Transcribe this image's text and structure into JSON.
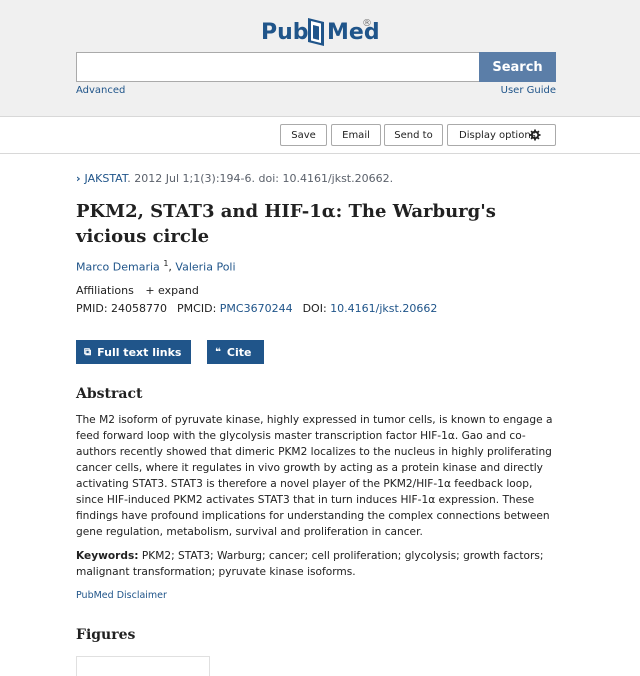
{
  "header": {
    "logo_pub": "Pub",
    "logo_med": "Med",
    "logo_reg": "®",
    "search_placeholder": "",
    "search_label": "Search",
    "advanced_label": "Advanced",
    "user_guide_label": "User Guide"
  },
  "toolbar": {
    "save_label": "Save",
    "email_label": "Email",
    "send_to_label": "Send to",
    "display_options_label": "Display options"
  },
  "article": {
    "journal": "JAKSTAT",
    "citation": ". 2012 Jul 1;1(3):194-6. doi: 10.4161/jkst.20662.",
    "title": "PKM2, STAT3 and HIF-1α: The Warburg's vicious circle",
    "authors": [
      {
        "name": "Marco Demaria",
        "sup": "1"
      },
      {
        "name": "Valeria Poli",
        "sup": ""
      }
    ],
    "affiliations_label": "Affiliations",
    "expand_label": "expand",
    "pmid_label": "PMID:",
    "pmid": "24058770",
    "pmcid_label": "PMCID:",
    "pmcid": "PMC3670244",
    "doi_label": "DOI:",
    "doi": "10.4161/jkst.20662",
    "full_text_label": "Full text links",
    "cite_label": "Cite",
    "abstract_heading": "Abstract",
    "abstract_text": "The M2 isoform of pyruvate kinase, highly expressed in tumor cells, is known to engage a feed forward loop with the glycolysis master transcription factor HIF-1α. Gao and co-authors recently showed that dimeric PKM2 localizes to the nucleus in highly proliferating cancer cells, where it regulates in vivo growth by acting as a protein kinase and directly activating STAT3. STAT3 is therefore a novel player of the PKM2/HIF-1α feedback loop, since HIF-induced PKM2 activates STAT3 that in turn induces HIF-1α expression. These findings have profound implications for understanding the complex connections between gene regulation, metabolism, survival and proliferation in cancer.",
    "keywords_label": "Keywords:",
    "keywords_text": " PKM2; STAT3; Warburg; cancer; cell proliferation; glycolysis; growth factors; malignant transformation; pyruvate kinase isoforms.",
    "disclaimer_label": "PubMed Disclaimer",
    "figures_heading": "Figures"
  },
  "colors": {
    "link": "#20558a",
    "search_button": "#5b7ea8",
    "dark_button": "#20558a"
  }
}
